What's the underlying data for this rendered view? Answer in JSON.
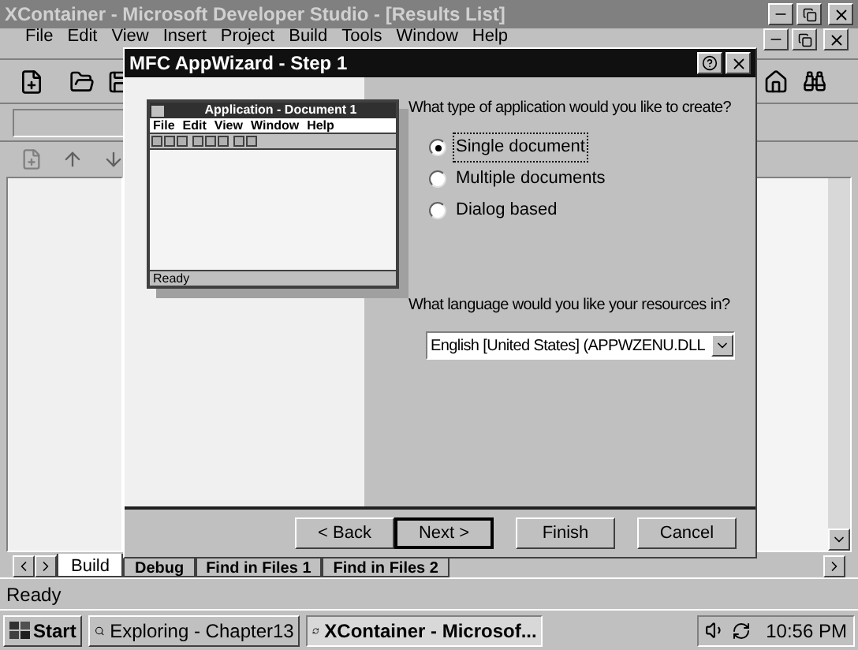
{
  "ide": {
    "title": "XContainer - Microsoft Developer Studio - [Results List]",
    "menu": [
      "File",
      "Edit",
      "View",
      "Insert",
      "Project",
      "Build",
      "Tools",
      "Window",
      "Help"
    ],
    "output_tabs": [
      {
        "label": "Build",
        "selected": true
      },
      {
        "label": "Debug",
        "selected": false
      },
      {
        "label": "Find in Files 1",
        "selected": false
      },
      {
        "label": "Find in Files 2",
        "selected": false
      }
    ],
    "status_bar": "Ready"
  },
  "dialog": {
    "title": "MFC AppWizard - Step 1",
    "preview": {
      "title": "Application - Document 1",
      "menu": [
        "File",
        "Edit",
        "View",
        "Window",
        "Help"
      ],
      "status": "Ready"
    },
    "question": "What type of application would you like to create?",
    "options": [
      {
        "label": "Single document",
        "selected": true
      },
      {
        "label": "Multiple documents",
        "selected": false
      },
      {
        "label": "Dialog based",
        "selected": false
      }
    ],
    "language_question": "What language would you like your resources in?",
    "language": "English [United States] (APPWZENU.DLL",
    "buttons": [
      {
        "label": "< Back",
        "default": false
      },
      {
        "label": "Next >",
        "default": true
      },
      {
        "label": "Finish",
        "default": false
      },
      {
        "label": "Cancel",
        "default": false
      }
    ]
  },
  "taskbar": {
    "start": "Start",
    "tasks": [
      {
        "label": "Exploring - Chapter13",
        "selected": false
      },
      {
        "label": "XContainer - Microsof...",
        "selected": true
      }
    ],
    "clock": "10:56 PM"
  }
}
